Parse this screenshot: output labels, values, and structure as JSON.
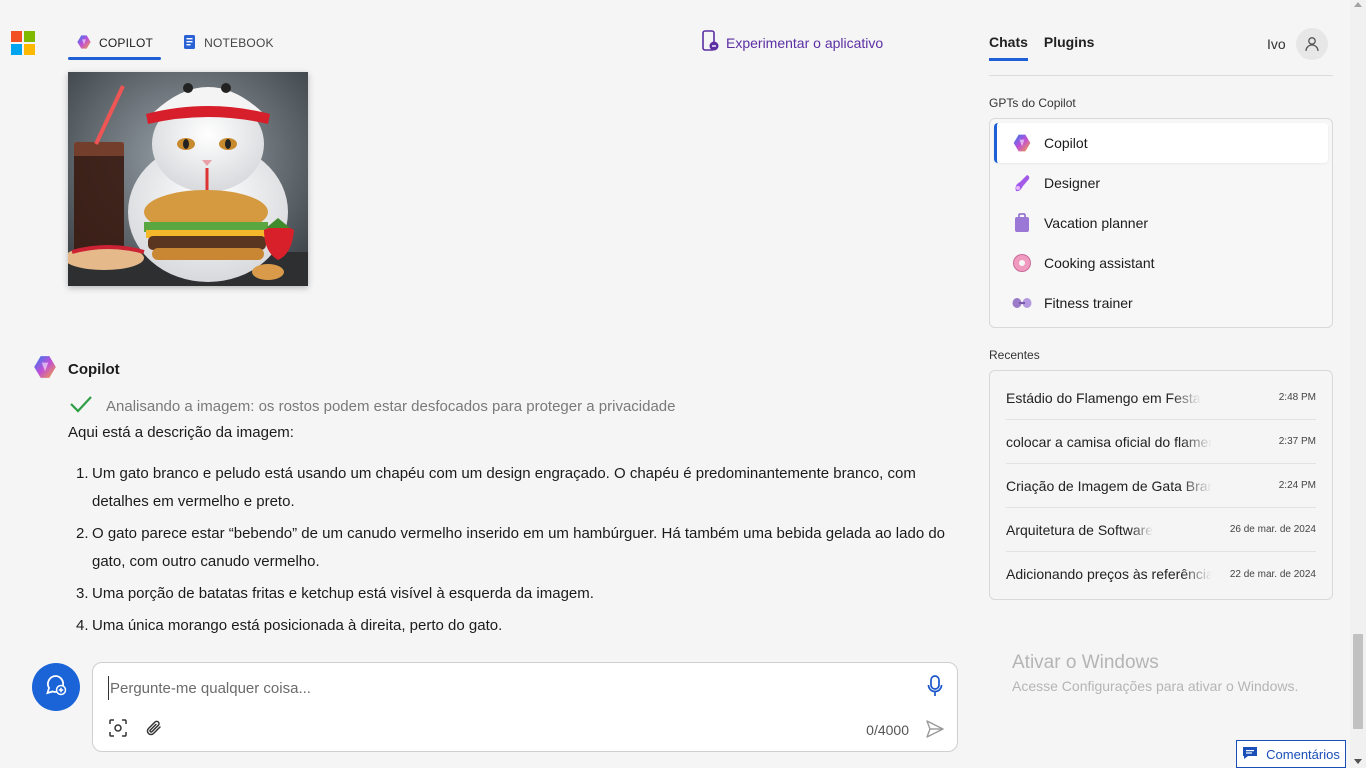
{
  "colors": {
    "accent": "#1f5fd6",
    "app_link": "#5b2fa3",
    "check": "#2e9e44",
    "new_chat": "#1a64d8"
  },
  "header": {
    "tabs": [
      {
        "label": "COPILOT",
        "icon": "copilot-icon",
        "active": true
      },
      {
        "label": "NOTEBOOK",
        "icon": "notebook-icon",
        "active": false
      }
    ],
    "try_app": "Experimentar o aplicativo"
  },
  "message": {
    "author": "Copilot",
    "status": "Analisando a imagem: os rostos podem estar desfocados para proteger a privacidade",
    "intro": "Aqui está a descrição da imagem:",
    "items": [
      {
        "num": "1.",
        "text": "Um gato branco e peludo está usando um chapéu com um design engraçado. O chapéu é predominantemente branco, com detalhes em vermelho e preto."
      },
      {
        "num": "2.",
        "text": "O gato parece estar “bebendo” de um canudo vermelho inserido em um hambúrguer. Há também uma bebida gelada ao lado do gato, com outro canudo vermelho."
      },
      {
        "num": "3.",
        "text": "Uma porção de batatas fritas e ketchup está visível à esquerda da imagem."
      },
      {
        "num": "4.",
        "text": "Uma única morango está posicionada à direita, perto do gato."
      }
    ]
  },
  "composer": {
    "placeholder": "Pergunte-me qualquer coisa...",
    "value": "",
    "counter": "0/4000"
  },
  "sidebar": {
    "tabs": [
      {
        "label": "Chats",
        "active": true
      },
      {
        "label": "Plugins",
        "active": false
      }
    ],
    "user": "Ivo",
    "gpts_label": "GPTs do Copilot",
    "gpts": [
      {
        "label": "Copilot",
        "icon": "copilot-icon",
        "active": true
      },
      {
        "label": "Designer",
        "icon": "designer-icon"
      },
      {
        "label": "Vacation planner",
        "icon": "suitcase-icon"
      },
      {
        "label": "Cooking assistant",
        "icon": "donut-icon"
      },
      {
        "label": "Fitness trainer",
        "icon": "dumbbell-icon"
      }
    ],
    "recent_label": "Recentes",
    "recents": [
      {
        "title": "Estádio do Flamengo em Festa",
        "time": "2:48 PM"
      },
      {
        "title": "colocar a camisa oficial do flamengo na gata",
        "time": "2:37 PM"
      },
      {
        "title": "Criação de Imagem de Gata Branca com Chapéu",
        "time": "2:24 PM"
      },
      {
        "title": "Arquitetura de Software",
        "time": "26 de mar. de 2024"
      },
      {
        "title": "Adicionando preços às referências",
        "time": "22 de mar. de 2024"
      }
    ]
  },
  "watermark": {
    "title": "Ativar o Windows",
    "subtitle": "Acesse Configurações para ativar o Windows."
  },
  "feedback": "Comentários"
}
